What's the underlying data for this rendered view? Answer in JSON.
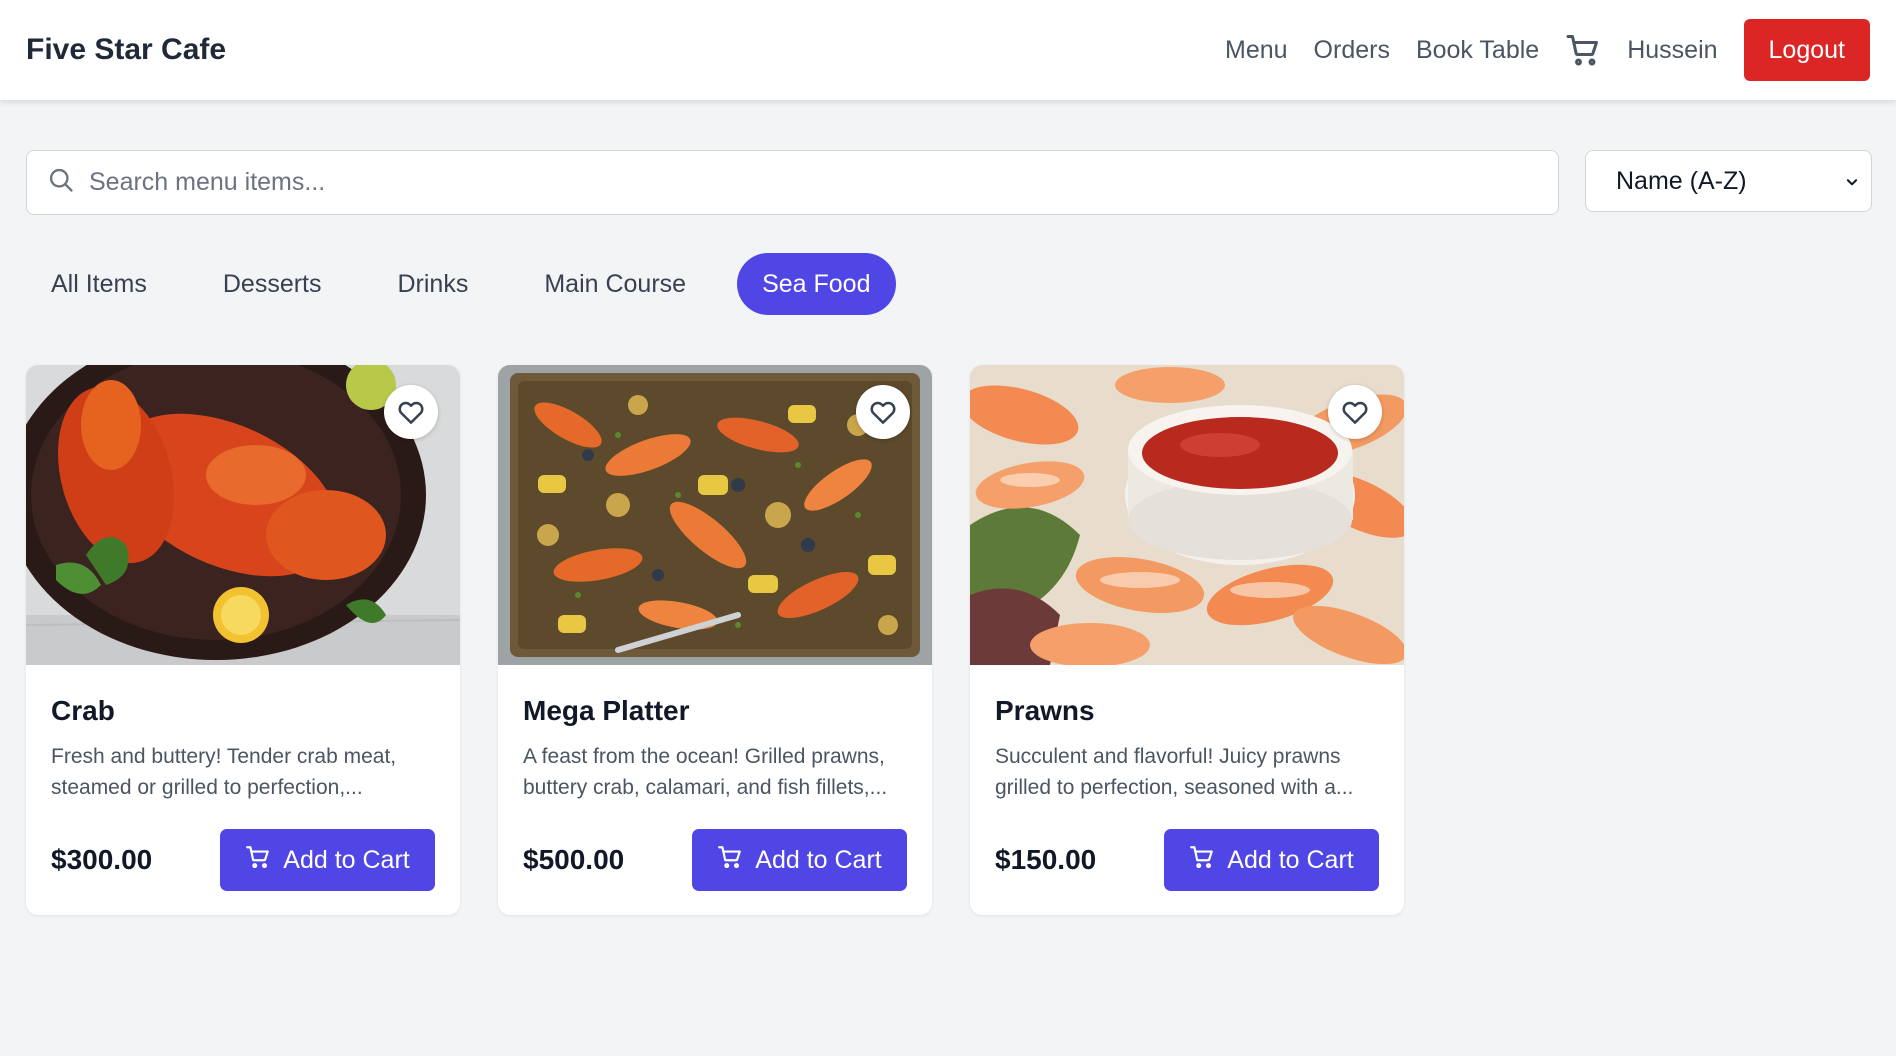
{
  "header": {
    "brand": "Five Star Cafe",
    "nav": [
      "Menu",
      "Orders",
      "Book Table"
    ],
    "cart_icon": "cart-icon",
    "user_name": "Hussein",
    "logout_label": "Logout",
    "logout_color": "#dc2626"
  },
  "search": {
    "placeholder": "Search menu items...",
    "value": "",
    "icon": "search-icon"
  },
  "sort": {
    "selected": "Name (A-Z)",
    "icon": "chevron-down-icon"
  },
  "categories": {
    "tabs": [
      "All Items",
      "Desserts",
      "Drinks",
      "Main Course",
      "Sea Food"
    ],
    "active": "Sea Food",
    "accent": "#4f46e5"
  },
  "items": [
    {
      "name": "Crab",
      "description": "Fresh and buttery! Tender crab meat, steamed or grilled to perfection,...",
      "price": "$300.00",
      "add_label": "Add to Cart",
      "image": "lobster-photo"
    },
    {
      "name": "Mega Platter",
      "description": "A feast from the ocean! Grilled prawns, buttery crab, calamari, and fish fillets,...",
      "price": "$500.00",
      "add_label": "Add to Cart",
      "image": "seafood-platter-photo"
    },
    {
      "name": "Prawns",
      "description": "Succulent and flavorful! Juicy prawns grilled to perfection, seasoned with a...",
      "price": "$150.00",
      "add_label": "Add to Cart",
      "image": "prawns-with-sauce-photo"
    }
  ]
}
